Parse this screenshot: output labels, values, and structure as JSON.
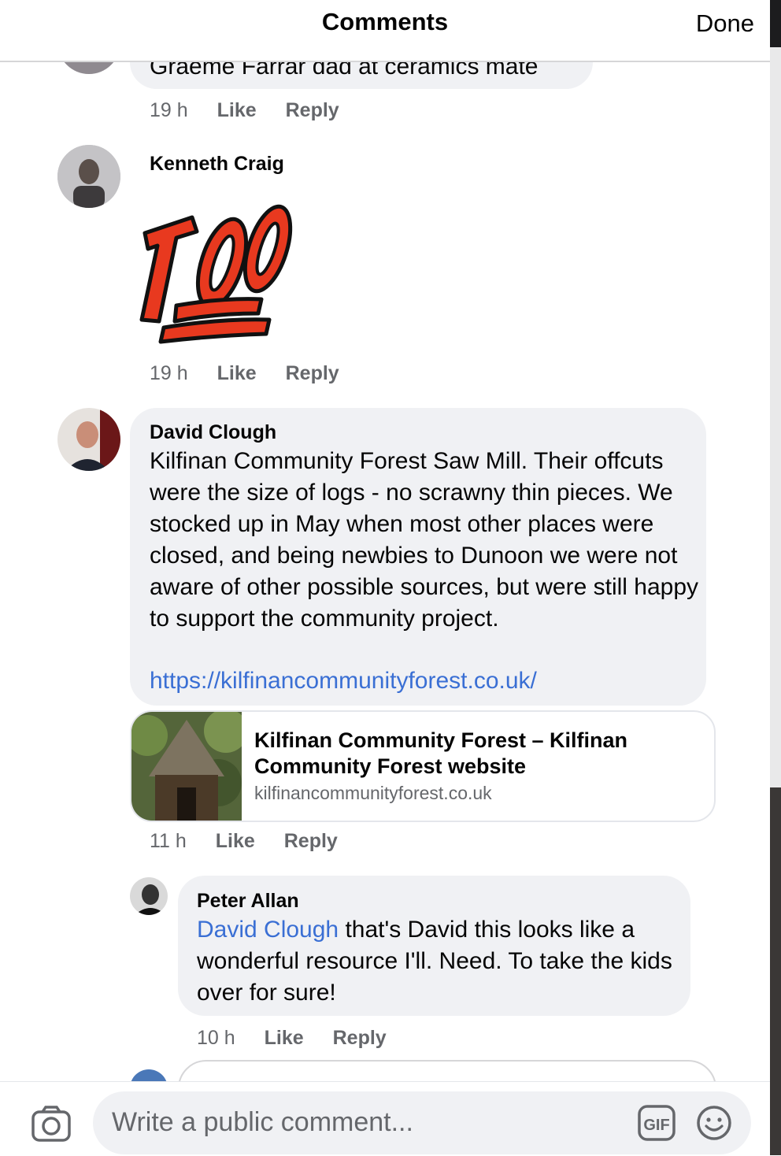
{
  "header": {
    "title": "Comments",
    "done_label": "Done"
  },
  "comments": [
    {
      "text": "Graeme Farrar dad at ceramics mate",
      "time": "19 h",
      "like": "Like",
      "reply": "Reply"
    },
    {
      "author": "Kenneth Craig",
      "sticker": "100",
      "time": "19 h",
      "like": "Like",
      "reply": "Reply"
    },
    {
      "author": "David Clough",
      "text": "Kilfinan Community Forest Saw Mill. Their offcuts were the size of logs - no scrawny thin pieces. We stocked up in May when most other places were closed, and being newbies to Dunoon we were not aware of other possible sources, but were still happy to support the community project.",
      "url": "https://kilfinancommunityforest.co.uk/",
      "preview": {
        "title": "Kilfinan Community Forest – Kilfinan Community Forest website",
        "domain": "kilfinancommunityforest.co.uk"
      },
      "time": "11 h",
      "like": "Like",
      "reply": "Reply"
    }
  ],
  "replies": [
    {
      "author": "Peter Allan",
      "mention": "David Clough",
      "text": " that's David this looks like a wonderful resource I'll. Need. To take the kids over for sure!",
      "time": "10 h",
      "like": "Like",
      "reply": "Reply"
    }
  ],
  "footer": {
    "placeholder": "Write a public comment...",
    "icons": [
      "camera-icon",
      "gif-icon",
      "emoji-icon"
    ]
  }
}
